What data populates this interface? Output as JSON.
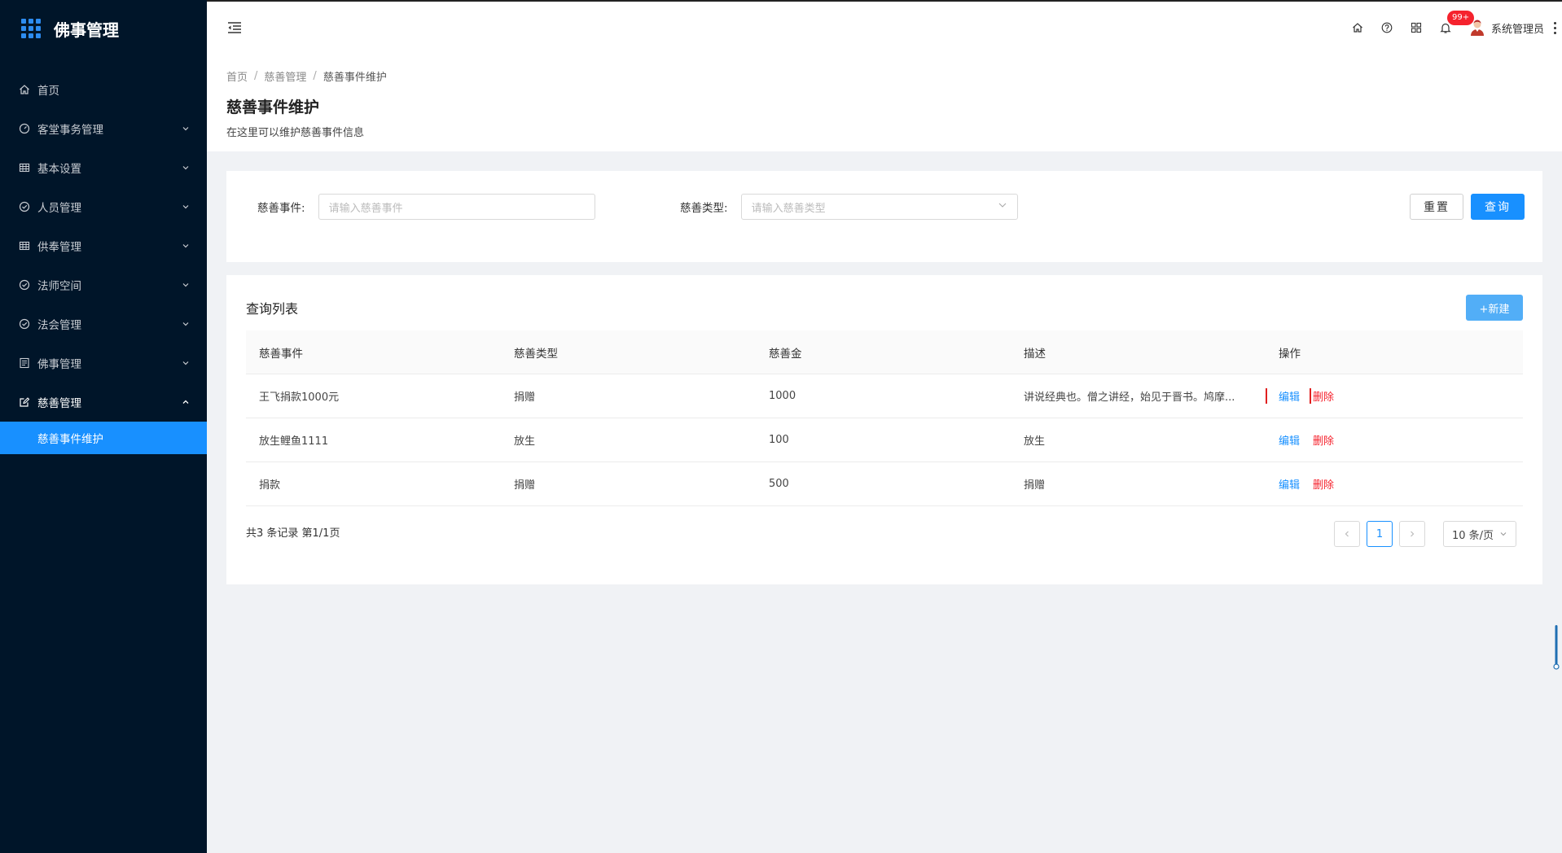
{
  "app": {
    "title": "佛事管理",
    "accent": "#1890ff",
    "sidebar_bg": "#001529"
  },
  "sidebar": {
    "items": [
      {
        "label": "首页",
        "icon": "home-icon"
      },
      {
        "label": "客堂事务管理",
        "icon": "dashboard-icon"
      },
      {
        "label": "基本设置",
        "icon": "table-icon"
      },
      {
        "label": "人员管理",
        "icon": "check-circle-icon"
      },
      {
        "label": "供奉管理",
        "icon": "table-icon"
      },
      {
        "label": "法师空间",
        "icon": "check-circle-icon"
      },
      {
        "label": "法会管理",
        "icon": "check-circle-icon"
      },
      {
        "label": "佛事管理",
        "icon": "profile-icon"
      },
      {
        "label": "慈善管理",
        "icon": "edit-icon"
      }
    ],
    "submenu": {
      "label": "慈善事件维护"
    }
  },
  "header": {
    "badge": "99+",
    "user_name": "系统管理员"
  },
  "breadcrumb": [
    "首页",
    "慈善管理",
    "慈善事件维护"
  ],
  "breadcrumb_sep": "/",
  "page": {
    "title": "慈善事件维护",
    "description": "在这里可以维护慈善事件信息"
  },
  "search": {
    "event_label": "慈善事件:",
    "event_placeholder": "请输入慈善事件",
    "type_label": "慈善类型:",
    "type_placeholder": "请输入慈善类型",
    "reset_label": "重置",
    "query_label": "查询"
  },
  "table": {
    "title": "查询列表",
    "new_label": "+新建",
    "columns": [
      "慈善事件",
      "慈善类型",
      "慈善金",
      "描述",
      "操作"
    ],
    "rows": [
      {
        "event": "王飞捐款1000元",
        "type": "捐赠",
        "amount": "1000",
        "desc": "讲说经典也。僧之讲经，始见于晋书。鸠摩...",
        "edit": "编辑",
        "del": "删除"
      },
      {
        "event": "放生鲤鱼1111",
        "type": "放生",
        "amount": "100",
        "desc": "放生",
        "edit": "编辑",
        "del": "删除"
      },
      {
        "event": "捐款",
        "type": "捐赠",
        "amount": "500",
        "desc": "捐赠",
        "edit": "编辑",
        "del": "删除"
      }
    ]
  },
  "pagination": {
    "total_text": "共3 条记录 第1/1页",
    "current_page": "1",
    "page_size": "10 条/页"
  }
}
